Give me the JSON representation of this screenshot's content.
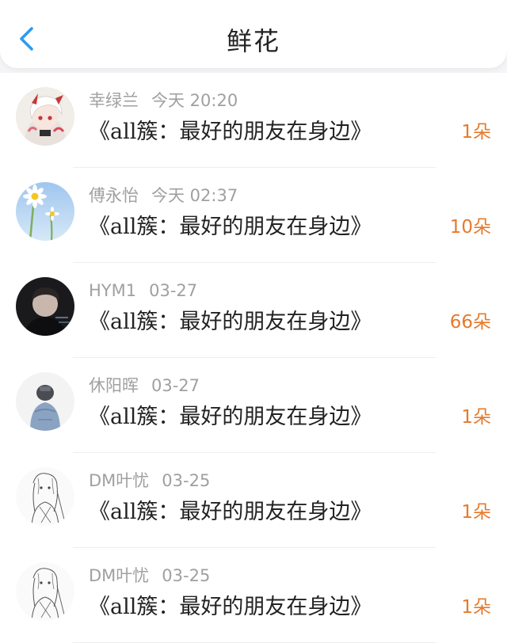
{
  "header": {
    "title": "鲜花",
    "back_icon": "chevron-left-icon",
    "accent_color": "#2b9cf2"
  },
  "flowers": [
    {
      "name": "幸绿兰",
      "time": "今天 20:20",
      "book": "《all簇：最好的朋友在身边》",
      "count": "1朵",
      "avatar": "anime-white-hair-avatar"
    },
    {
      "name": "傅永怡",
      "time": "今天 02:37",
      "book": "《all簇：最好的朋友在身边》",
      "count": "10朵",
      "avatar": "daisy-sky-avatar"
    },
    {
      "name": "HYM1",
      "time": "03-27",
      "book": "《all簇：最好的朋友在身边》",
      "count": "66朵",
      "avatar": "dark-portrait-avatar"
    },
    {
      "name": "休阳晖",
      "time": "03-27",
      "book": "《all簇：最好的朋友在身边》",
      "count": "1朵",
      "avatar": "person-back-avatar"
    },
    {
      "name": "DM叶忧",
      "time": "03-25",
      "book": "《all簇：最好的朋友在身边》",
      "count": "1朵",
      "avatar": "sketch-girl-avatar"
    },
    {
      "name": "DM叶忧",
      "time": "03-25",
      "book": "《all簇：最好的朋友在身边》",
      "count": "1朵",
      "avatar": "sketch-girl-avatar"
    }
  ],
  "colors": {
    "count": "#e57a2c",
    "meta": "#a0a0a0",
    "text": "#222222"
  }
}
